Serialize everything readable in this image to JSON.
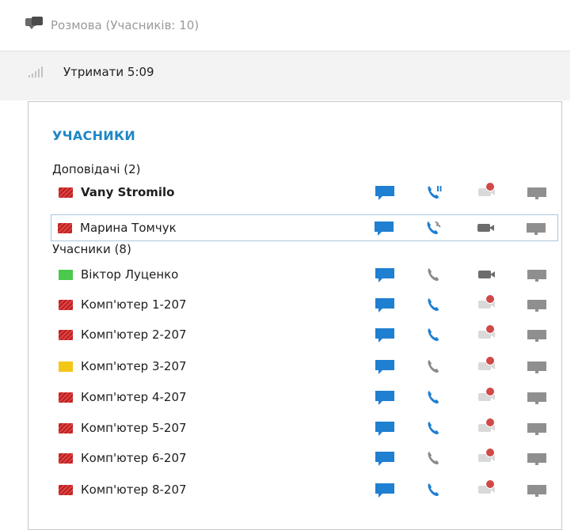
{
  "conversation": {
    "title": "Розмова (Учасників: 10)",
    "icon": "conversation-icon"
  },
  "hold": {
    "label": "Утримати 5:09"
  },
  "panel": {
    "title": "УЧАСНИКИ",
    "presenters_label": "Доповідачі (2)",
    "attendees_label": "Учасники (8)"
  },
  "participants": [
    {
      "name": "Vany Stromilo",
      "status": "busy",
      "bold": true,
      "phone": "on-hold",
      "video": "unavailable"
    },
    {
      "name": "Марина Томчук",
      "status": "busy",
      "bold": false,
      "phone": "muted",
      "video": "available",
      "selected": true
    },
    {
      "name": "Віктор Луценко",
      "status": "available",
      "bold": false,
      "phone": "inactive",
      "video": "available"
    },
    {
      "name": "Комп'ютер 1-207",
      "status": "busy",
      "bold": false,
      "phone": "active",
      "video": "unavailable"
    },
    {
      "name": "Комп'ютер 2-207",
      "status": "busy",
      "bold": false,
      "phone": "active",
      "video": "unavailable"
    },
    {
      "name": "Комп'ютер 3-207",
      "status": "away",
      "bold": false,
      "phone": "inactive",
      "video": "unavailable"
    },
    {
      "name": "Комп'ютер 4-207",
      "status": "busy",
      "bold": false,
      "phone": "active",
      "video": "unavailable"
    },
    {
      "name": "Комп'ютер 5-207",
      "status": "busy",
      "bold": false,
      "phone": "active",
      "video": "unavailable"
    },
    {
      "name": "Комп'ютер 6-207",
      "status": "busy",
      "bold": false,
      "phone": "inactive",
      "video": "unavailable"
    },
    {
      "name": "Комп'ютер 8-207",
      "status": "busy",
      "bold": false,
      "phone": "active",
      "video": "unavailable"
    }
  ],
  "colors": {
    "accent": "#1f86c6",
    "chat": "#1f7fd1",
    "busy": "#d43a3a",
    "available": "#4cc84c",
    "away": "#f4c716"
  }
}
